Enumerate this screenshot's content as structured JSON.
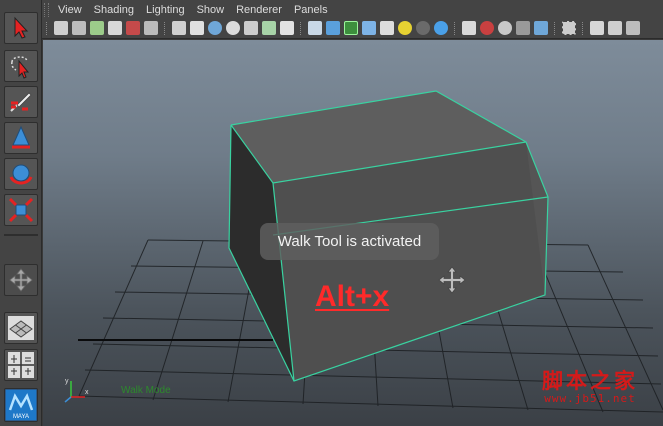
{
  "menus": [
    "View",
    "Shading",
    "Lighting",
    "Show",
    "Renderer",
    "Panels"
  ],
  "viewport": {
    "toast": "Walk Tool is activated",
    "shortcut": "Alt+x",
    "status_line": "Walk Mode",
    "status_line_2": ""
  },
  "axis": {
    "x_label": "x",
    "y_label": "y"
  },
  "watermark": {
    "text": "脚本之家",
    "url": "www.jb51.net"
  },
  "toolbox": {
    "items": [
      "select-tool",
      "lasso-tool",
      "paint-select-tool",
      "move-tool",
      "rotate-tool",
      "scale-tool",
      "manipulator-tool",
      "single-pane-layout",
      "four-pane-layout",
      "maya-logo"
    ],
    "logo_text": "MAYA"
  },
  "colors": {
    "selection_highlight": "#39d2a0",
    "shortcut_text": "#ff2a2a",
    "watermark": "#d41a1a",
    "ui_panel": "#444444"
  }
}
